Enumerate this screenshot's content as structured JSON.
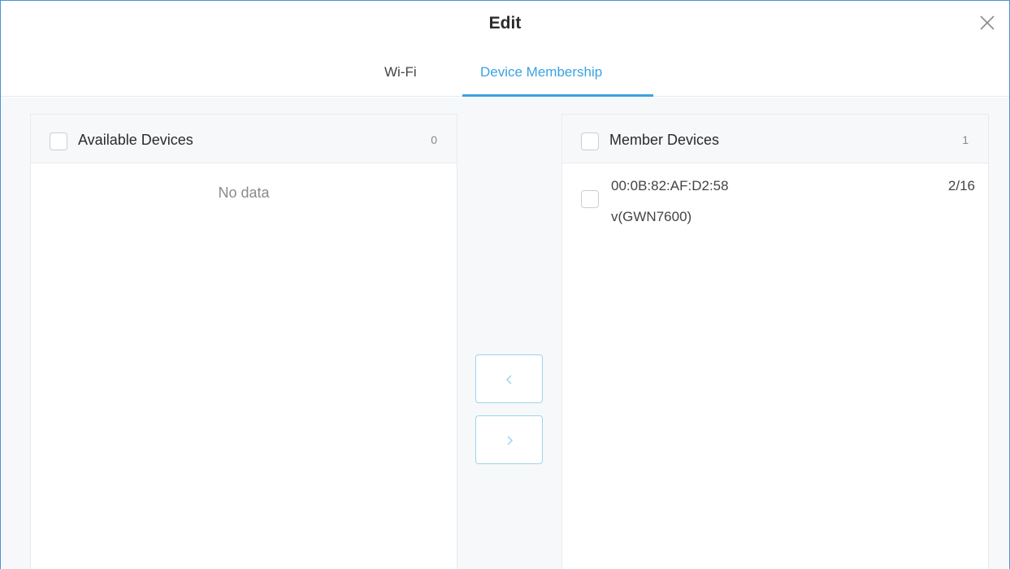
{
  "dialog": {
    "title": "Edit"
  },
  "tabs": [
    {
      "label": "Wi-Fi",
      "active": false
    },
    {
      "label": "Device Membership",
      "active": true
    }
  ],
  "available_panel": {
    "header_label": "Available Devices",
    "count": "0",
    "empty_text": "No data",
    "items": []
  },
  "member_panel": {
    "header_label": "Member Devices",
    "count": "1",
    "items": [
      {
        "mac": "00:0B:82:AF:D2:58",
        "model": "v(GWN7600)",
        "ratio": "2/16"
      }
    ]
  },
  "transfer": {
    "left_icon": "chevron-left-icon",
    "right_icon": "chevron-right-icon"
  },
  "colors": {
    "accent": "#3aa3e3",
    "border": "#e8eaee",
    "dialog_border": "#4a90d9"
  }
}
